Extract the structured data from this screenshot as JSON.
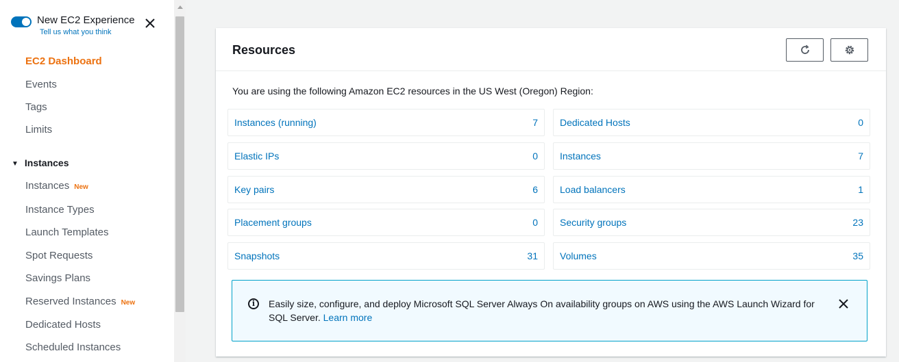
{
  "experience": {
    "title": "New EC2 Experience",
    "subtitle": "Tell us what you think"
  },
  "nav": {
    "items": [
      {
        "label": "EC2 Dashboard"
      },
      {
        "label": "Events"
      },
      {
        "label": "Tags"
      },
      {
        "label": "Limits"
      }
    ],
    "section_instances": "Instances",
    "instances_items": [
      {
        "label": "Instances",
        "badge": "New"
      },
      {
        "label": "Instance Types"
      },
      {
        "label": "Launch Templates"
      },
      {
        "label": "Spot Requests"
      },
      {
        "label": "Savings Plans"
      },
      {
        "label": "Reserved Instances",
        "badge": "New"
      },
      {
        "label": "Dedicated Hosts"
      },
      {
        "label": "Scheduled Instances"
      }
    ]
  },
  "resources": {
    "title": "Resources",
    "intro": "You are using the following Amazon EC2 resources in the US West (Oregon) Region:",
    "left": [
      {
        "label": "Instances (running)",
        "count": "7"
      },
      {
        "label": "Elastic IPs",
        "count": "0"
      },
      {
        "label": "Key pairs",
        "count": "6"
      },
      {
        "label": "Placement groups",
        "count": "0"
      },
      {
        "label": "Snapshots",
        "count": "31"
      }
    ],
    "right": [
      {
        "label": "Dedicated Hosts",
        "count": "0"
      },
      {
        "label": "Instances",
        "count": "7"
      },
      {
        "label": "Load balancers",
        "count": "1"
      },
      {
        "label": "Security groups",
        "count": "23"
      },
      {
        "label": "Volumes",
        "count": "35"
      }
    ]
  },
  "info": {
    "icon_glyph": "i",
    "text": "Easily size, configure, and deploy Microsoft SQL Server Always On availability groups on AWS using the AWS Launch Wizard for SQL Server.",
    "link": "Learn more"
  },
  "colors": {
    "accent": "#ec7211",
    "link": "#0073bb",
    "info_border": "#00a1c9",
    "info_bg": "#f1faff"
  }
}
